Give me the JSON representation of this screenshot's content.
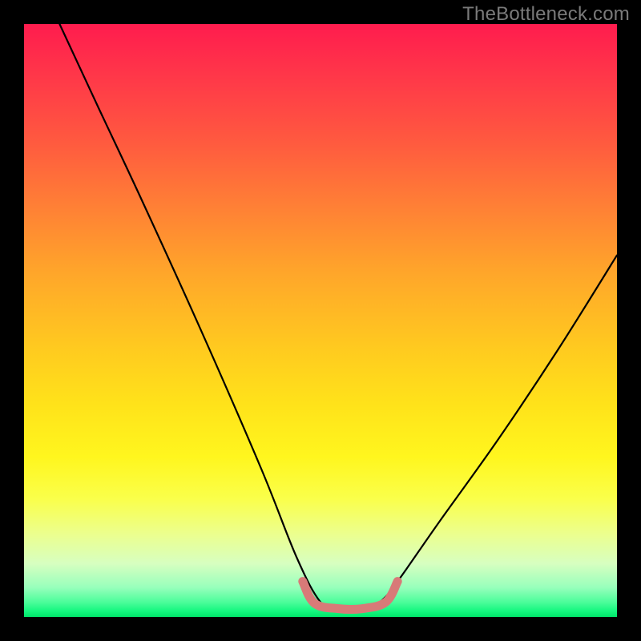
{
  "watermark": {
    "text": "TheBottleneck.com"
  },
  "chart_data": {
    "type": "line",
    "title": "",
    "xlabel": "",
    "ylabel": "",
    "xlim": [
      0,
      100
    ],
    "ylim": [
      0,
      100
    ],
    "grid": false,
    "legend": false,
    "series": [
      {
        "name": "bottleneck-curve",
        "x": [
          6,
          12.5,
          20,
          30,
          40,
          46,
          50,
          53,
          55,
          57,
          60,
          63,
          70,
          80,
          90,
          100
        ],
        "y": [
          100,
          86,
          70,
          48,
          25,
          10,
          2.5,
          1,
          1,
          1,
          2.5,
          6,
          16,
          30,
          45,
          61
        ],
        "color": "#000000"
      },
      {
        "name": "optimal-band-highlight",
        "x": [
          47,
          49,
          53,
          57,
          61,
          63
        ],
        "y": [
          6,
          2.3,
          1.4,
          1.4,
          2.5,
          6
        ],
        "color": "#d87a78"
      }
    ],
    "gradient_legend": {
      "top_color_meaning": "high-bottleneck",
      "bottom_color_meaning": "no-bottleneck",
      "stops": [
        {
          "pos": 0.0,
          "color": "#ff1c4e"
        },
        {
          "pos": 0.5,
          "color": "#ffd21c"
        },
        {
          "pos": 1.0,
          "color": "#00e56a"
        }
      ]
    }
  }
}
